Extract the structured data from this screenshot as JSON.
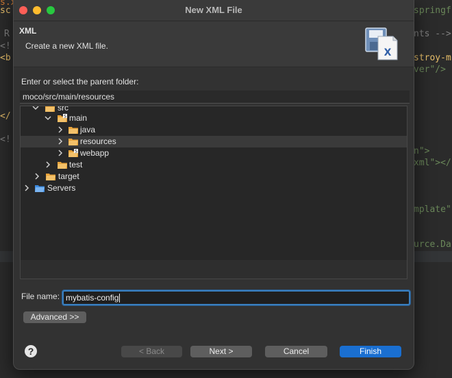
{
  "background_editor": {
    "lines": [
      {
        "text": "s.x",
        "color": "#cc7832"
      },
      {
        "text": "sc",
        "color": "#e8bf6a"
      },
      {
        "text": "springf",
        "color": "#6a8759"
      },
      {
        "text": "R",
        "color": "#808080"
      },
      {
        "text": "nts -->",
        "color": "#808080"
      },
      {
        "text": "<!",
        "color": "#808080"
      },
      {
        "text": "stroy-m",
        "color": "#e8bf6a"
      },
      {
        "text": "<b",
        "color": "#e8bf6a"
      },
      {
        "text": "ver\"/>",
        "color": "#6a8759"
      },
      {
        "text": "</",
        "color": "#e8bf6a"
      },
      {
        "text": "<!",
        "color": "#808080"
      },
      {
        "text": "n\">",
        "color": "#6a8759"
      },
      {
        "text": "xml\"></",
        "color": "#6a8759"
      },
      {
        "text": "mplate\"",
        "color": "#6a8759"
      },
      {
        "text": "urce.Da",
        "color": "#6a8759"
      }
    ]
  },
  "dialog": {
    "title": "New XML File",
    "header_title": "XML",
    "header_description": "Create a new XML file.",
    "parent_folder_label": "Enter or select the parent folder:",
    "parent_folder_value": "moco/src/main/resources",
    "tree": [
      {
        "label": "src",
        "expanded": true,
        "selected": false
      },
      {
        "label": "main",
        "expanded": true,
        "selected": false
      },
      {
        "label": "java",
        "expanded": false,
        "selected": false
      },
      {
        "label": "resources",
        "expanded": false,
        "selected": true
      },
      {
        "label": "webapp",
        "expanded": false,
        "selected": false
      },
      {
        "label": "test",
        "expanded": false,
        "selected": false
      },
      {
        "label": "target",
        "expanded": false,
        "selected": false
      },
      {
        "label": "Servers",
        "expanded": false,
        "selected": false
      }
    ],
    "file_name_label": "File name:",
    "file_name_value": "mybatis-config",
    "advanced_button": "Advanced >>",
    "back_button": "< Back",
    "next_button": "Next >",
    "cancel_button": "Cancel",
    "finish_button": "Finish",
    "help_glyph": "?"
  },
  "colors": {
    "accent": "#1a6fd1",
    "focus_ring": "#3a7fbf",
    "folder": "#e8a33a"
  },
  "icons": [
    "close-icon",
    "minimize-icon",
    "zoom-icon",
    "xml-file-wizard-icon",
    "chevron-right-icon",
    "chevron-down-icon",
    "folder-icon",
    "help-icon"
  ]
}
